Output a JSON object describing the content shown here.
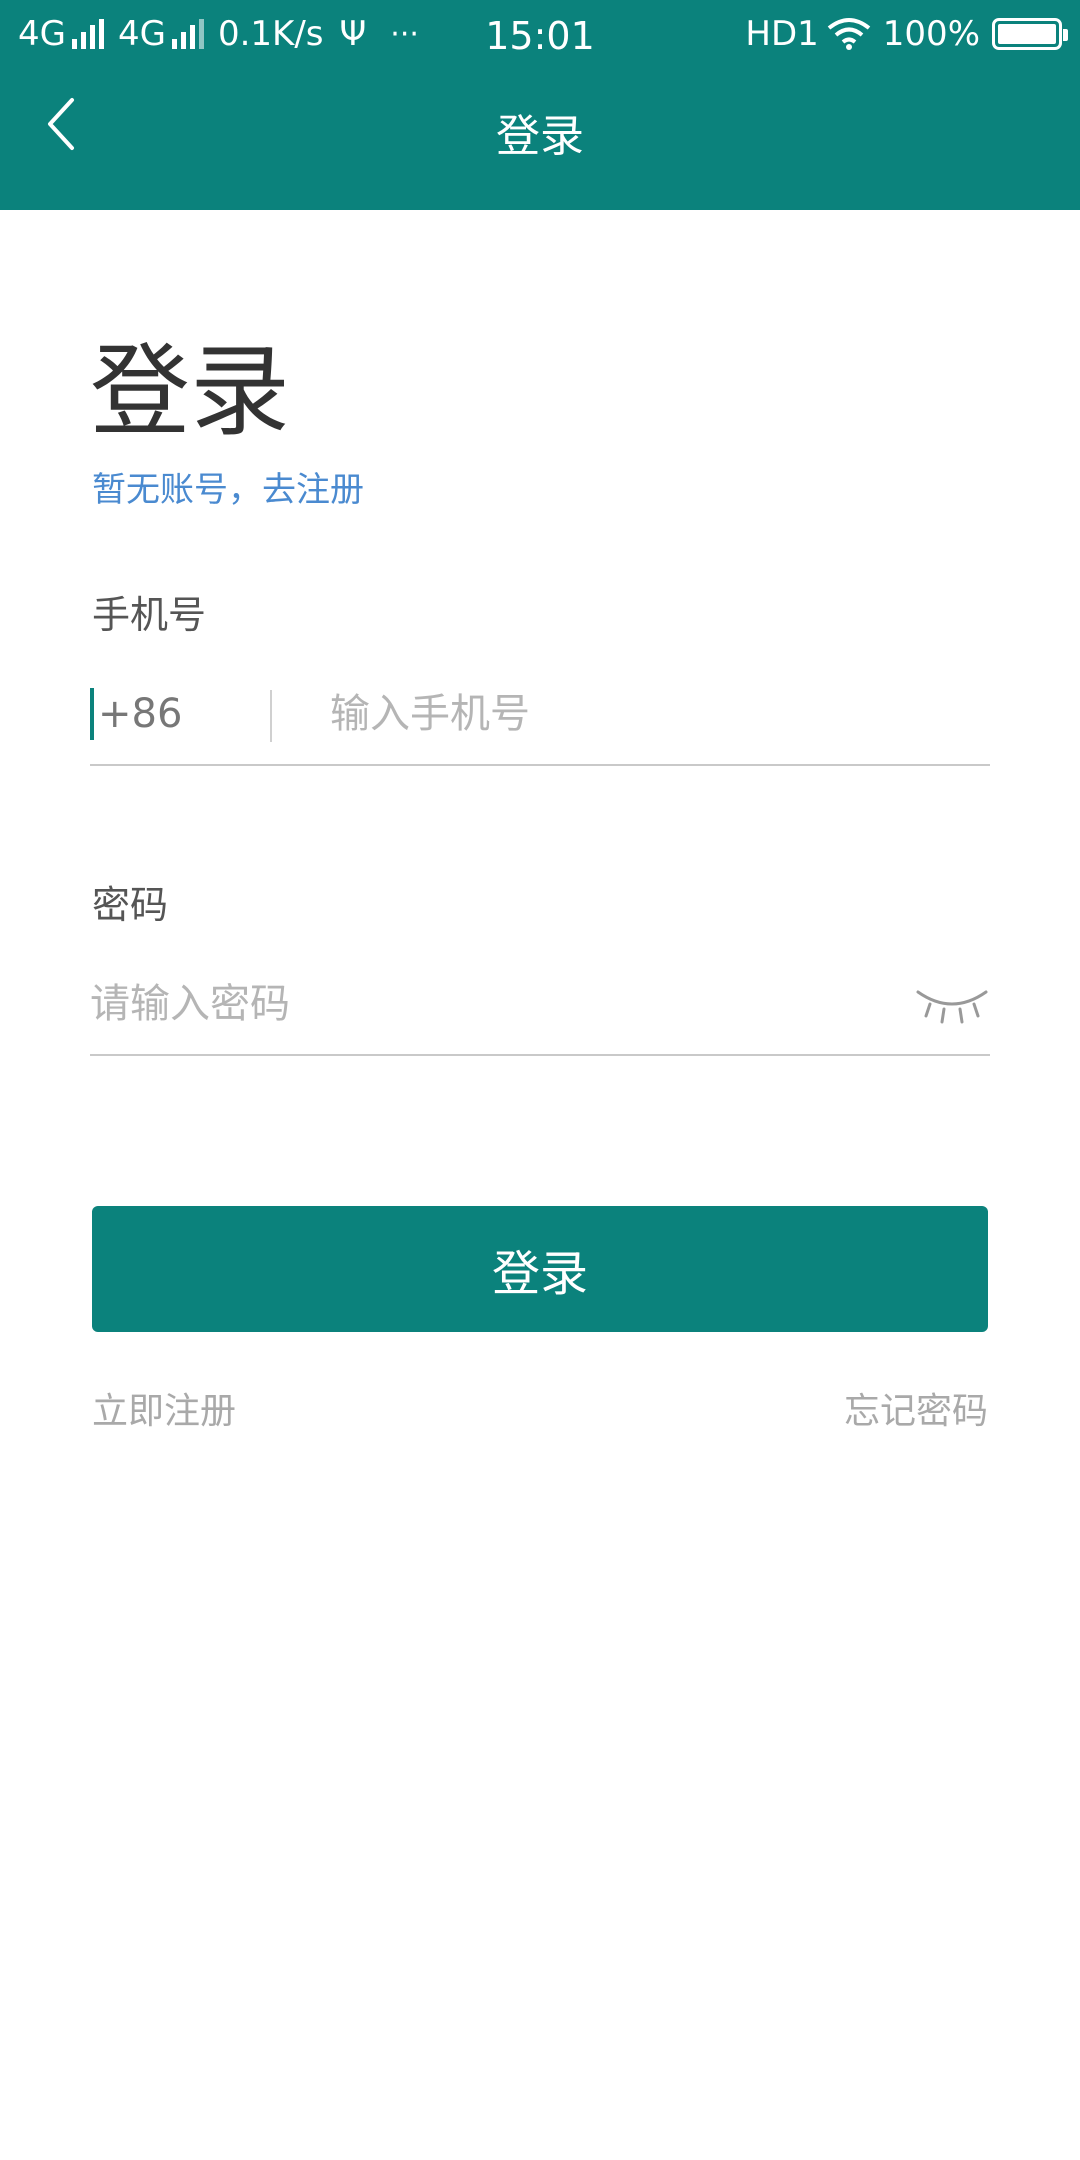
{
  "status_bar": {
    "net1": "4G",
    "net2": "4G",
    "speed": "0.1K/s",
    "usb_glyph": "Ψ",
    "more": "···",
    "time": "15:01",
    "hd": "HD1",
    "battery": "100%",
    "battery_level_percent": 100
  },
  "nav": {
    "title": "登录"
  },
  "page": {
    "heading": "登录",
    "register_hint": "暂无账号，去注册"
  },
  "form": {
    "phone_label": "手机号",
    "country_code": "+86",
    "phone_placeholder": "输入手机号",
    "phone_value": "",
    "password_label": "密码",
    "password_placeholder": "请输入密码",
    "password_value": ""
  },
  "actions": {
    "login_label": "登录",
    "register_now": "立即注册",
    "forgot_password": "忘记密码"
  },
  "colors": {
    "brand": "#0b827c",
    "link": "#4a8ad0"
  },
  "icons": {
    "back": "back-arrow-icon",
    "password_visibility": "eye-closed-icon",
    "wifi": "wifi-icon",
    "battery": "battery-icon"
  }
}
